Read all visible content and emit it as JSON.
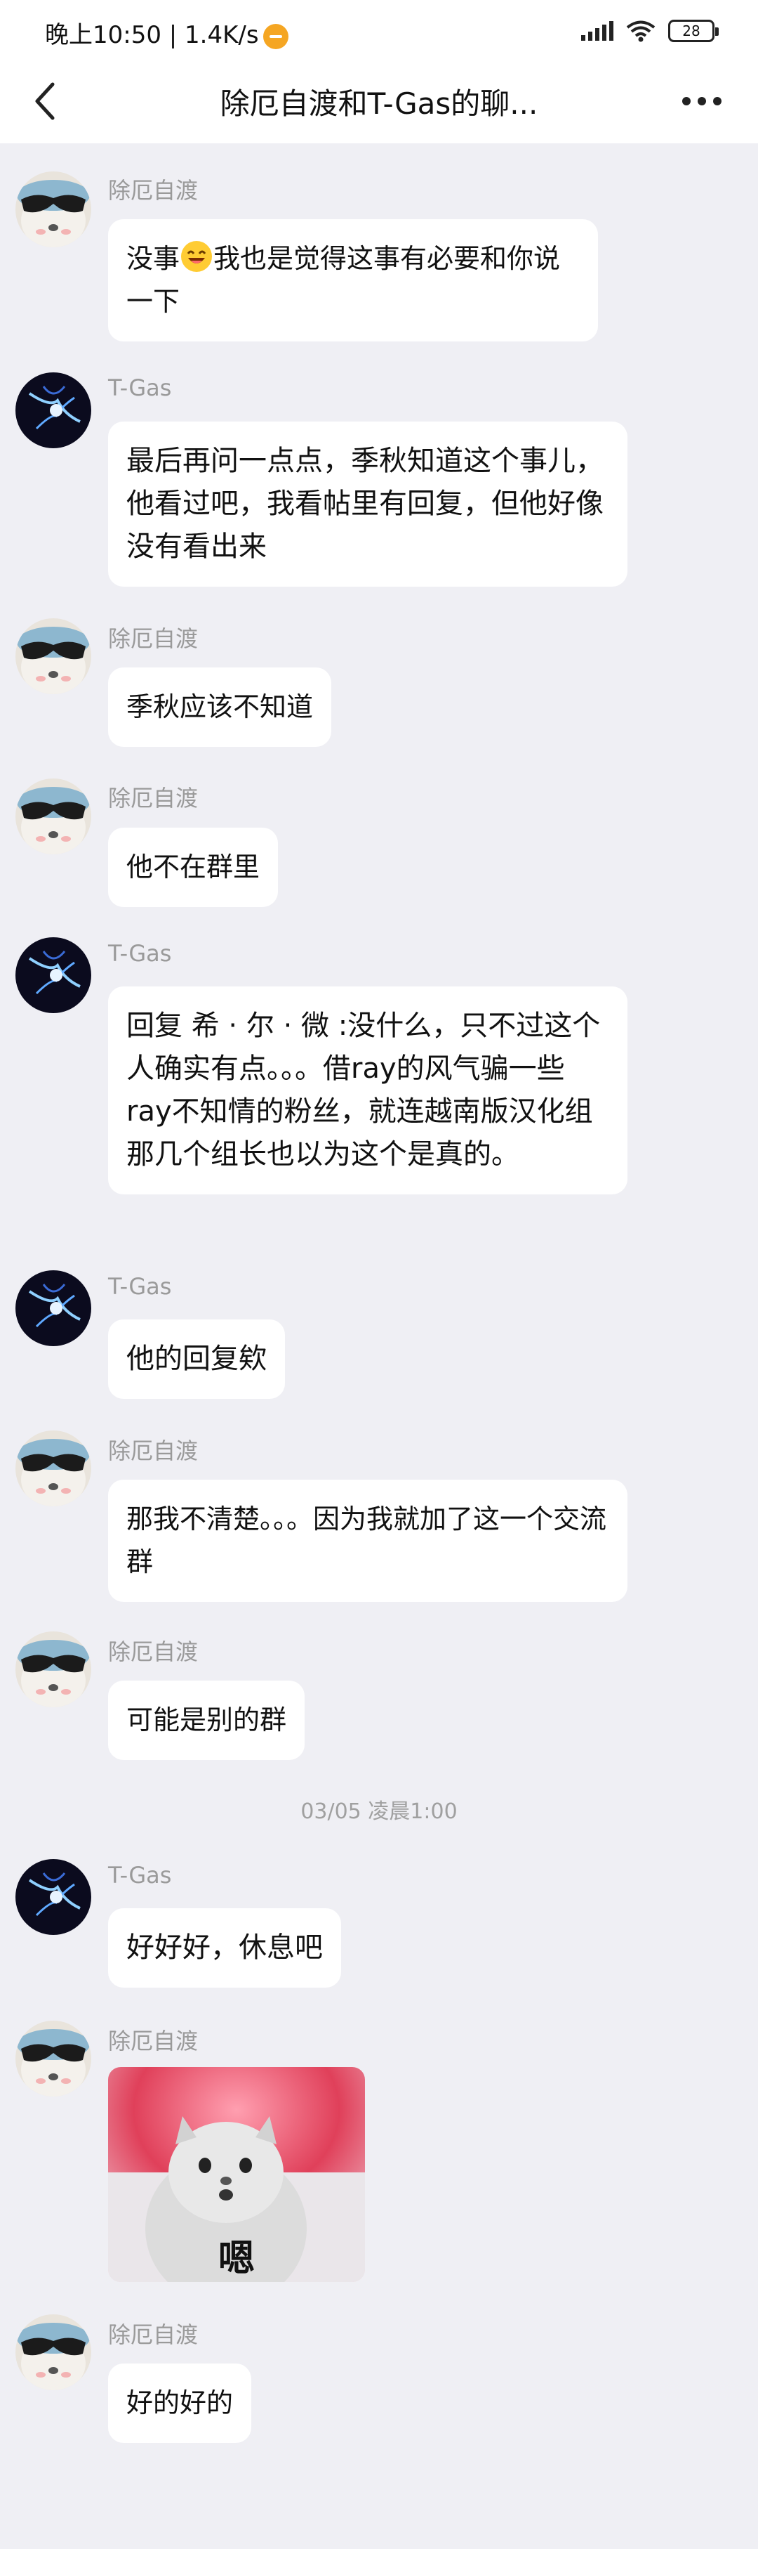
{
  "status_bar": {
    "time_speed": "晚上10:50 | 1.4K/s",
    "battery": "28"
  },
  "header": {
    "title": "除厄自渡和T-Gas的聊..."
  },
  "senders": {
    "a": "除厄自渡",
    "b": "T-Gas"
  },
  "messages": [
    {
      "text_before": "没事",
      "text_after": "我也是觉得这事有必要和你说一下"
    },
    {
      "text": "最后再问一点点，季秋知道这个事儿，他看过吧，我看帖里有回复，但他好像没有看出来"
    },
    {
      "text": "季秋应该不知道"
    },
    {
      "text": "他不在群里"
    },
    {
      "text": "回复 希 · 尔 · 微 :没什么，只不过这个人确实有点。。。借ray的风气骗一些ray不知情的粉丝，就连越南版汉化组那几个组长也以为这个是真的。"
    },
    {
      "text": "他的回复欸"
    },
    {
      "text": "那我不清楚。。。因为我就加了这一个交流群"
    },
    {
      "text": "可能是别的群"
    },
    {
      "text": "好好好，休息吧"
    },
    {
      "sticker_caption": "嗯"
    },
    {
      "text": "好的好的"
    }
  ],
  "timestamp": "03/05 凌晨1:00",
  "icons": {
    "back": "back-arrow-icon",
    "more": "more-dots-icon",
    "signal": "signal-icon",
    "wifi": "wifi-icon",
    "battery": "battery-icon",
    "emoji": "laughing-emoji-icon"
  },
  "colors": {
    "background": "#efeff4",
    "bubble": "#ffffff",
    "sender_name": "#9a9a9a",
    "timestamp": "#a0a0a0"
  }
}
